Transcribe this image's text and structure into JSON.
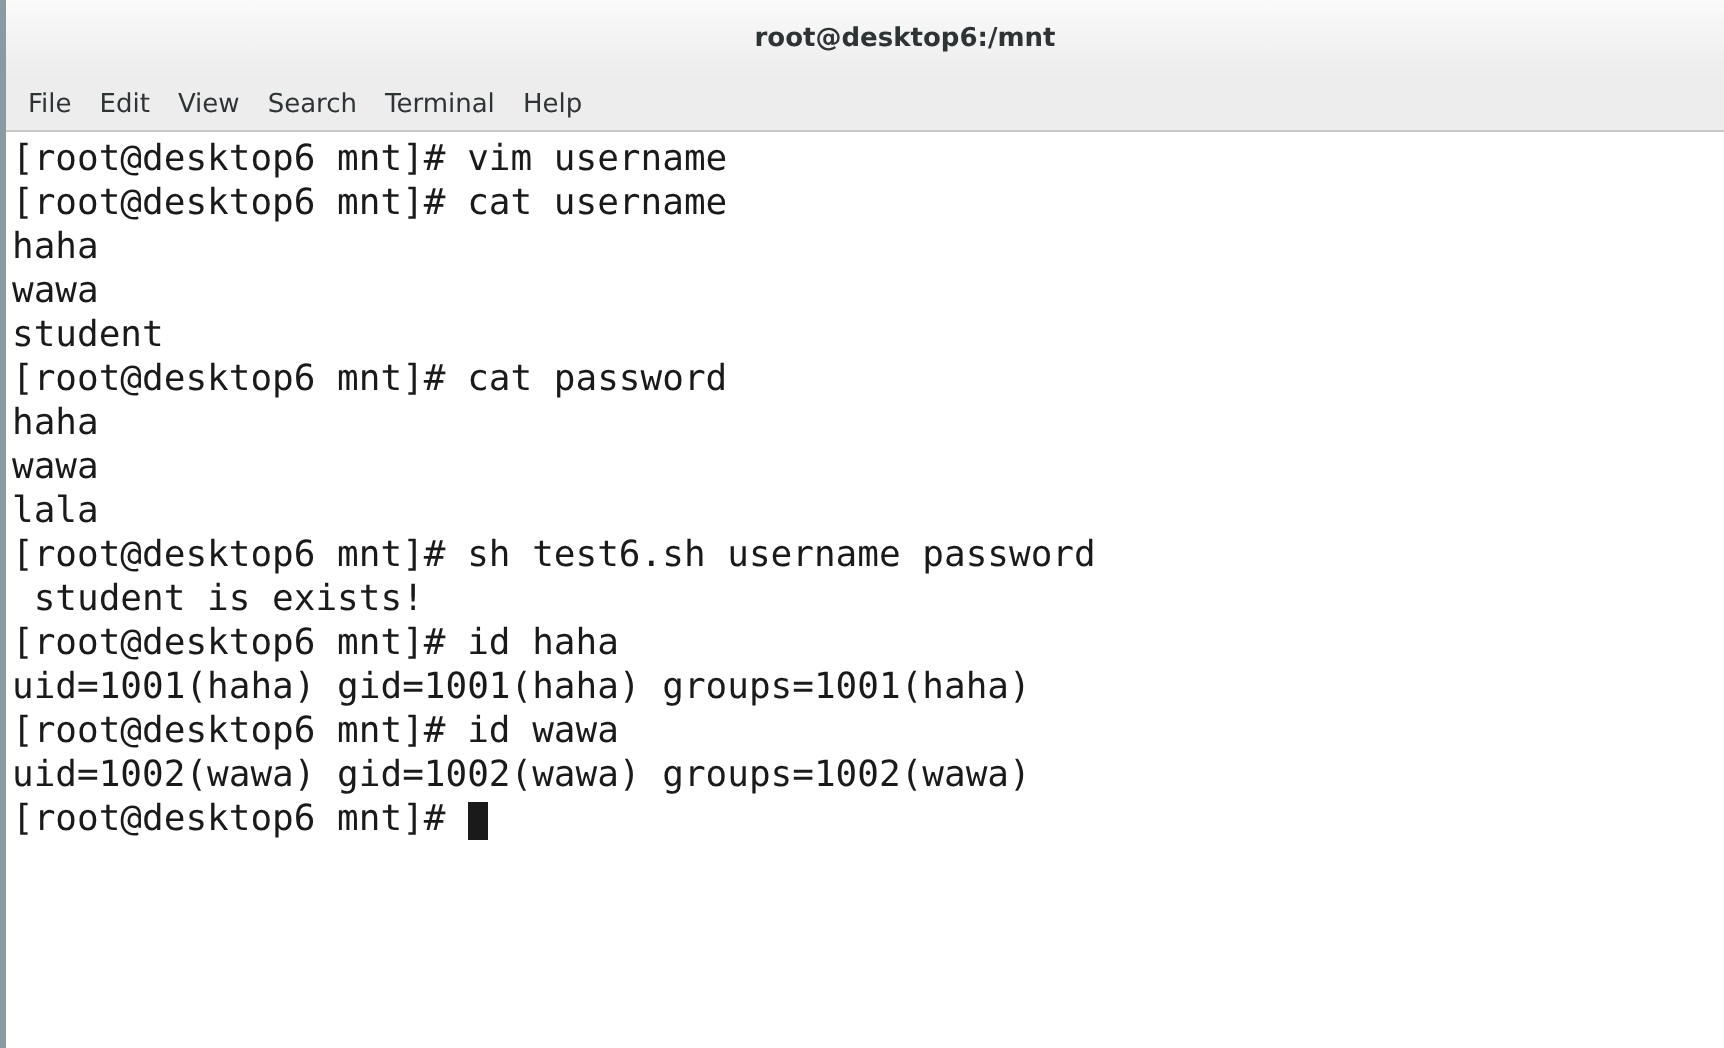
{
  "window": {
    "title": "root@desktop6:/mnt"
  },
  "menu": [
    "File",
    "Edit",
    "View",
    "Search",
    "Terminal",
    "Help"
  ],
  "terminal": {
    "lines": [
      "[root@desktop6 mnt]# vim username",
      "[root@desktop6 mnt]# cat username",
      "haha",
      "wawa",
      "student",
      "[root@desktop6 mnt]# cat password",
      "haha",
      "wawa",
      "lala",
      "[root@desktop6 mnt]# sh test6.sh username password",
      " student is exists!",
      "[root@desktop6 mnt]# id haha",
      "uid=1001(haha) gid=1001(haha) groups=1001(haha)",
      "[root@desktop6 mnt]# id wawa",
      "uid=1002(wawa) gid=1002(wawa) groups=1002(wawa)"
    ],
    "prompt": "[root@desktop6 mnt]# ",
    "cursor": true
  }
}
